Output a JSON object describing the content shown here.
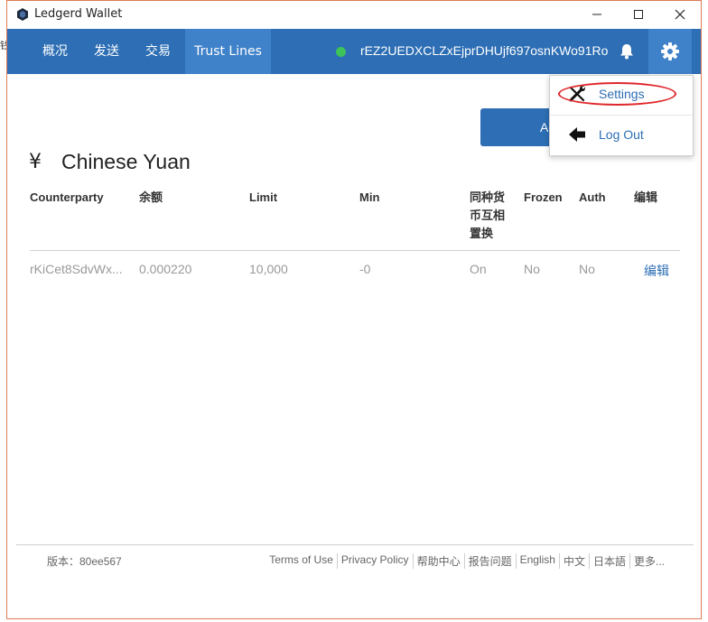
{
  "window": {
    "title": "Ledgerd Wallet",
    "left_stub": "钱"
  },
  "nav": {
    "tabs": [
      {
        "label": "概况"
      },
      {
        "label": "发送"
      },
      {
        "label": "交易"
      },
      {
        "label": "Trust Lines",
        "active": true
      }
    ],
    "address": "rEZ2UEDXCLZxEjprDHUjf697osnKWo91Ro",
    "status_color": "#3ec35b",
    "icons": [
      "bell-icon",
      "gear-icon"
    ]
  },
  "menu": {
    "items": [
      {
        "label": "Settings",
        "icon": "wrench-screwdriver-icon"
      },
      {
        "label": "Log Out",
        "icon": "arrow-left-icon"
      }
    ]
  },
  "partially_hidden_button": {
    "label": "A"
  },
  "currency": {
    "symbol": "¥",
    "name": "Chinese Yuan"
  },
  "table": {
    "headers": [
      "Counterparty",
      "余额",
      "Limit",
      "Min",
      "同种货\n币互相\n置换",
      "Frozen",
      "Auth",
      "编辑"
    ],
    "rows": [
      {
        "counterparty": "rKiCet8SdvWx...",
        "balance": "0.000220",
        "limit": "10,000",
        "min": "-0",
        "rippling": "On",
        "frozen": "No",
        "auth": "No",
        "edit": "编辑"
      }
    ]
  },
  "footer": {
    "version": "版本：80ee567",
    "links": [
      "Terms of Use",
      "Privacy Policy",
      "帮助中心",
      "报告问题",
      "English",
      "中文",
      "日本語",
      "更多..."
    ]
  },
  "colors": {
    "brand": "#2d6eb4",
    "nav_active": "#3f82c9",
    "highlight_ellipse": "#e0262b"
  }
}
